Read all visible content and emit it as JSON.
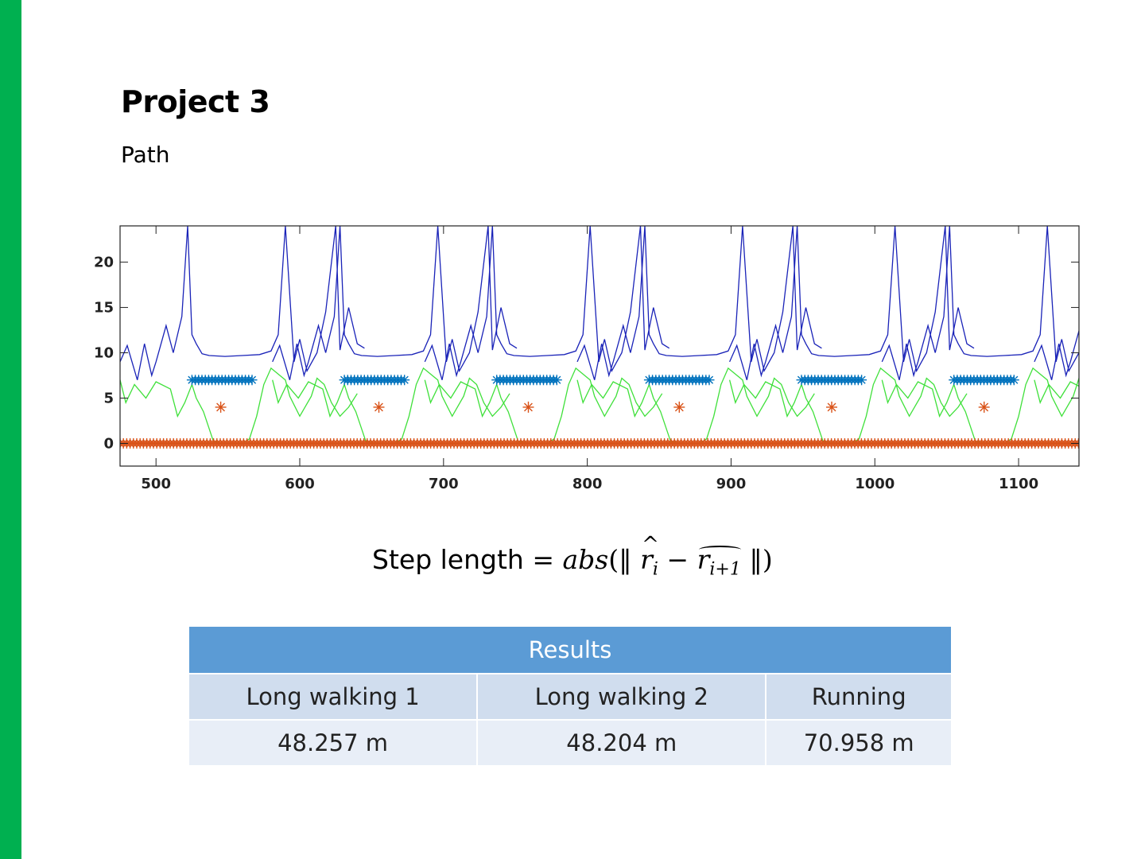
{
  "slide": {
    "title": "Project 3",
    "subtitle": "Path",
    "accent_color": "#00b050"
  },
  "formula": {
    "lhs": "Step length",
    "equals": "=",
    "fn": "abs",
    "open": "(‖",
    "r": "r",
    "sub_i": "i",
    "minus": "−",
    "sub_i1": "i+1",
    "close": "‖)"
  },
  "results_table": {
    "header": "Results",
    "columns": [
      "Long walking 1",
      "Long walking 2",
      "Running"
    ],
    "values": [
      "48.257 m",
      "48.204 m",
      "70.958 m"
    ],
    "header_color": "#5b9bd5"
  },
  "chart_data": {
    "type": "line",
    "title": "",
    "xlabel": "",
    "ylabel": "",
    "xlim": [
      475,
      1142
    ],
    "ylim": [
      -2.5,
      24
    ],
    "xticks": [
      500,
      600,
      700,
      800,
      900,
      1000,
      1100
    ],
    "yticks": [
      0,
      5,
      10,
      15,
      20
    ],
    "grid": false,
    "period_start": 520,
    "period": 106,
    "colors": {
      "blue_line": "#1a23b8",
      "green_line": "#3fe03a",
      "blue_markers": "#0072bd",
      "orange_markers": "#d95319"
    },
    "series": [
      {
        "kind": "line",
        "color_key": "blue_line",
        "x": [
          475,
          480,
          487,
          492,
          497,
          500,
          507,
          512,
          518,
          522,
          525,
          528,
          532,
          537,
          548,
          560,
          572,
          580,
          585,
          590,
          596,
          600,
          605,
          612,
          618,
          625,
          628,
          634,
          640,
          645
        ],
        "y": [
          9,
          10.8,
          7,
          11,
          7.5,
          9,
          13,
          10,
          14,
          24,
          12,
          11,
          9.9,
          9.7,
          9.6,
          9.7,
          9.8,
          10.2,
          12,
          24,
          9,
          11.5,
          8,
          10,
          14.5,
          24,
          10.3,
          15,
          11,
          10.5
        ]
      },
      {
        "kind": "line",
        "color_key": "green_line",
        "x": [
          475,
          479,
          485,
          493,
          500,
          510,
          515,
          520,
          525,
          528,
          533,
          540,
          550,
          560,
          565,
          570,
          575,
          580,
          590,
          593,
          600,
          608,
          612,
          617,
          622,
          628,
          634,
          640
        ],
        "y": [
          7,
          4.5,
          6.5,
          5,
          6.8,
          6,
          3,
          4.5,
          6.5,
          5,
          3.5,
          0.2,
          0,
          0,
          0.5,
          3,
          6.5,
          8.3,
          7,
          5.2,
          3,
          5.2,
          7.2,
          6.5,
          4.5,
          3,
          4,
          5.5
        ]
      },
      {
        "kind": "markers",
        "marker": "asterisk",
        "color_key": "blue_markers",
        "y": 7,
        "x_range": [
          525,
          568
        ]
      },
      {
        "kind": "markers",
        "marker": "asterisk",
        "color_key": "orange_markers",
        "y": 4,
        "x": [
          545,
          655,
          759,
          864,
          970,
          1076
        ]
      },
      {
        "kind": "markers",
        "marker": "asterisk",
        "color_key": "orange_markers",
        "y": 0,
        "x_range": [
          475,
          1142
        ]
      }
    ]
  }
}
